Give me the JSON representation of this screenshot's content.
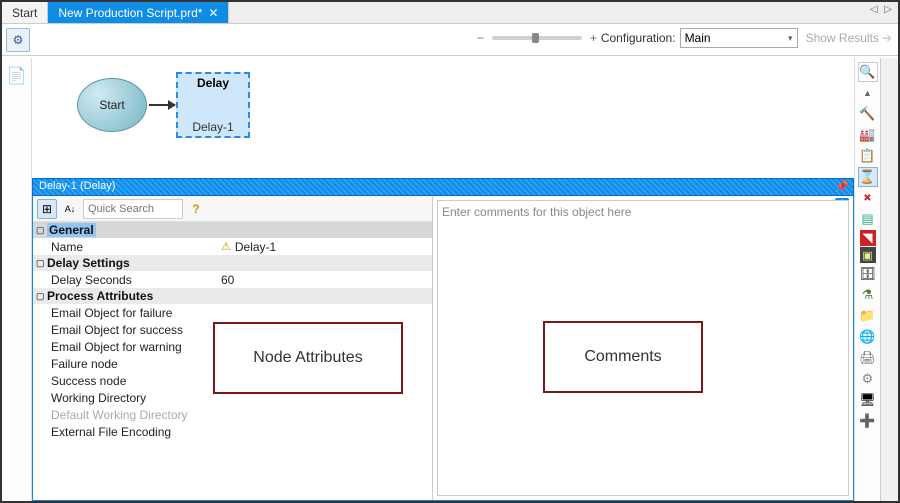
{
  "tabs": {
    "start": "Start",
    "active": "New Production Script.prd*",
    "close": "✕"
  },
  "toolbar": {
    "config_label": "Configuration:",
    "config_value": "Main",
    "show_results": "Show Results",
    "minus": "−",
    "plus": "+"
  },
  "canvas": {
    "start_label": "Start",
    "delay_title": "Delay",
    "delay_name": "Delay-1"
  },
  "panel": {
    "title": "Delay-1 (Delay)",
    "search_placeholder": "Quick Search",
    "comment_placeholder": "Enter comments for this object here",
    "groups": {
      "general": "General",
      "delay_settings": "Delay Settings",
      "process_attr": "Process Attributes"
    },
    "rows": {
      "name_k": "Name",
      "name_v": "Delay-1",
      "delay_sec_k": "Delay Seconds",
      "delay_sec_v": "60",
      "eofail": "Email Object for failure",
      "eosucc": "Email Object for success",
      "eowarn": "Email Object for warning",
      "failnode": "Failure node",
      "succnode": "Success node",
      "workdir": "Working Directory",
      "defworkdir": "Default Working Directory",
      "extenc": "External File Encoding"
    }
  },
  "annotations": {
    "node_attr": "Node Attributes",
    "comments": "Comments"
  },
  "glyphs": {
    "gear": "⚙",
    "doc": "📄",
    "pin": "📌",
    "cat": "⊞",
    "az": "A↓",
    "help": "?",
    "info": "i",
    "left": "◁",
    "right": "▷",
    "arrow": "➔",
    "search": "🔍",
    "tri": "▲",
    "hammer": "🔨",
    "factory": "🏭",
    "copy": "📋",
    "hourglass": "⌛",
    "x": "✖",
    "tableg": "▤",
    "redflag": "◥",
    "term": "▣",
    "db": "🗄",
    "funnel": "⚗",
    "folder": "📁",
    "globe": "🌐",
    "print": "🖨",
    "cog2": "⚙",
    "mon": "🖥",
    "plus": "➕",
    "chev": "▾"
  }
}
